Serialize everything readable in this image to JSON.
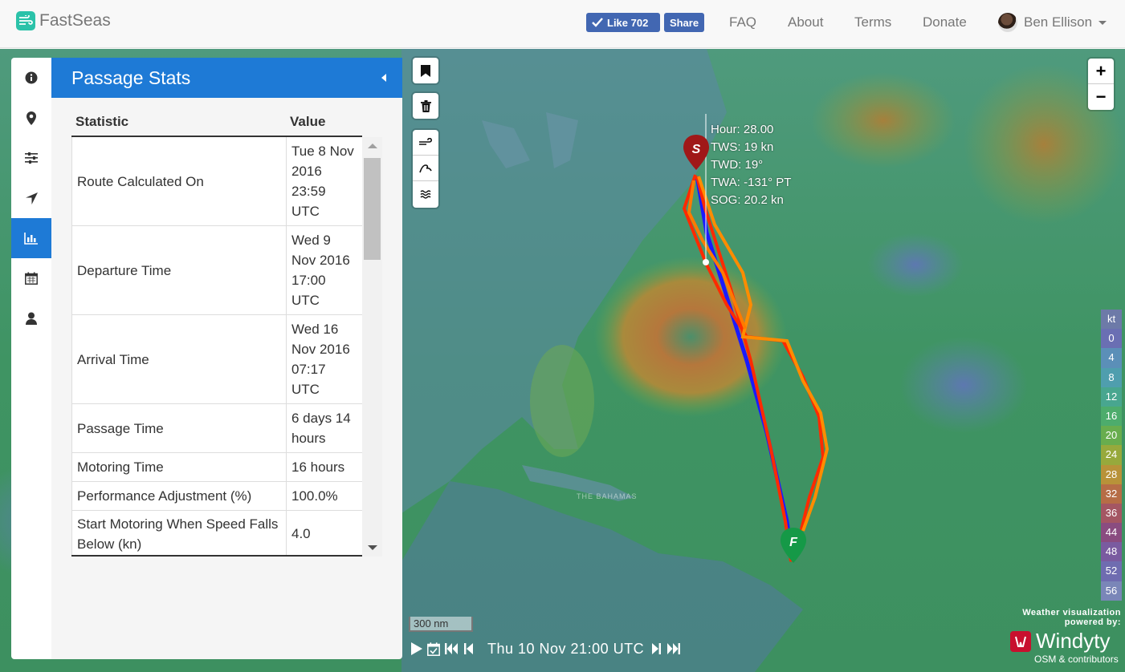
{
  "navbar": {
    "brand": "FastSeas",
    "fb_like": "Like 702",
    "fb_share": "Share",
    "links": [
      "FAQ",
      "About",
      "Terms",
      "Donate"
    ],
    "user": "Ben Ellison"
  },
  "rail": {
    "icons": [
      "info-icon",
      "map-marker-icon",
      "sliders-icon",
      "location-arrow-icon",
      "bar-chart-icon",
      "calendar-icon",
      "user-icon"
    ],
    "active": "bar-chart-icon"
  },
  "panel": {
    "title": "Passage Stats",
    "headers": {
      "statistic": "Statistic",
      "value": "Value"
    },
    "rows": [
      {
        "label": "Route Calculated On",
        "value": "Tue 8 Nov 2016 23:59 UTC"
      },
      {
        "label": "Departure Time",
        "value": "Wed 9 Nov 2016 17:00 UTC"
      },
      {
        "label": "Arrival Time",
        "value": "Wed 16 Nov 2016 07:17 UTC"
      },
      {
        "label": "Passage Time",
        "value": "6 days 14 hours"
      },
      {
        "label": "Motoring Time",
        "value": "16 hours"
      },
      {
        "label": "Performance Adjustment (%)",
        "value": "100.0%"
      },
      {
        "label": "Start Motoring When Speed Falls Below (kn)",
        "value": "4.0"
      }
    ]
  },
  "map": {
    "start_marker": "S",
    "finish_marker": "F",
    "map_label": "THE BAHAMAS",
    "tooltip": {
      "hour": "Hour: 28.00",
      "tws": "TWS: 19 kn",
      "twd": "TWD: 19°",
      "twa": "TWA: -131° PT",
      "sog": "SOG: 20.2 kn"
    },
    "zoom_in": "+",
    "zoom_out": "−",
    "legend_unit": "kt",
    "legend": [
      "0",
      "4",
      "8",
      "12",
      "16",
      "20",
      "24",
      "28",
      "32",
      "36",
      "44",
      "48",
      "52",
      "56"
    ],
    "legend_colors": [
      "#6a6fb3",
      "#5b8fb8",
      "#4f9eae",
      "#48a68f",
      "#4dac6c",
      "#68ad4e",
      "#97a93c",
      "#b89239",
      "#b66d46",
      "#a45663",
      "#8a4c80",
      "#7a5ba0",
      "#6f6cb0",
      "#7a86b8"
    ],
    "scale": "300 nm",
    "time": "Thu 10 Nov 21:00 UTC",
    "credit_line1": "Weather visualization",
    "credit_line2": "powered by:",
    "windy": "Windyty",
    "osm": "OSM & contributors"
  },
  "colors": {
    "primary": "#1e7ad6",
    "route_blue": "#1a1aff",
    "route_red": "#ff2a00",
    "route_orange": "#ff8c00",
    "start_marker": "#a01818",
    "finish_marker": "#159947"
  }
}
